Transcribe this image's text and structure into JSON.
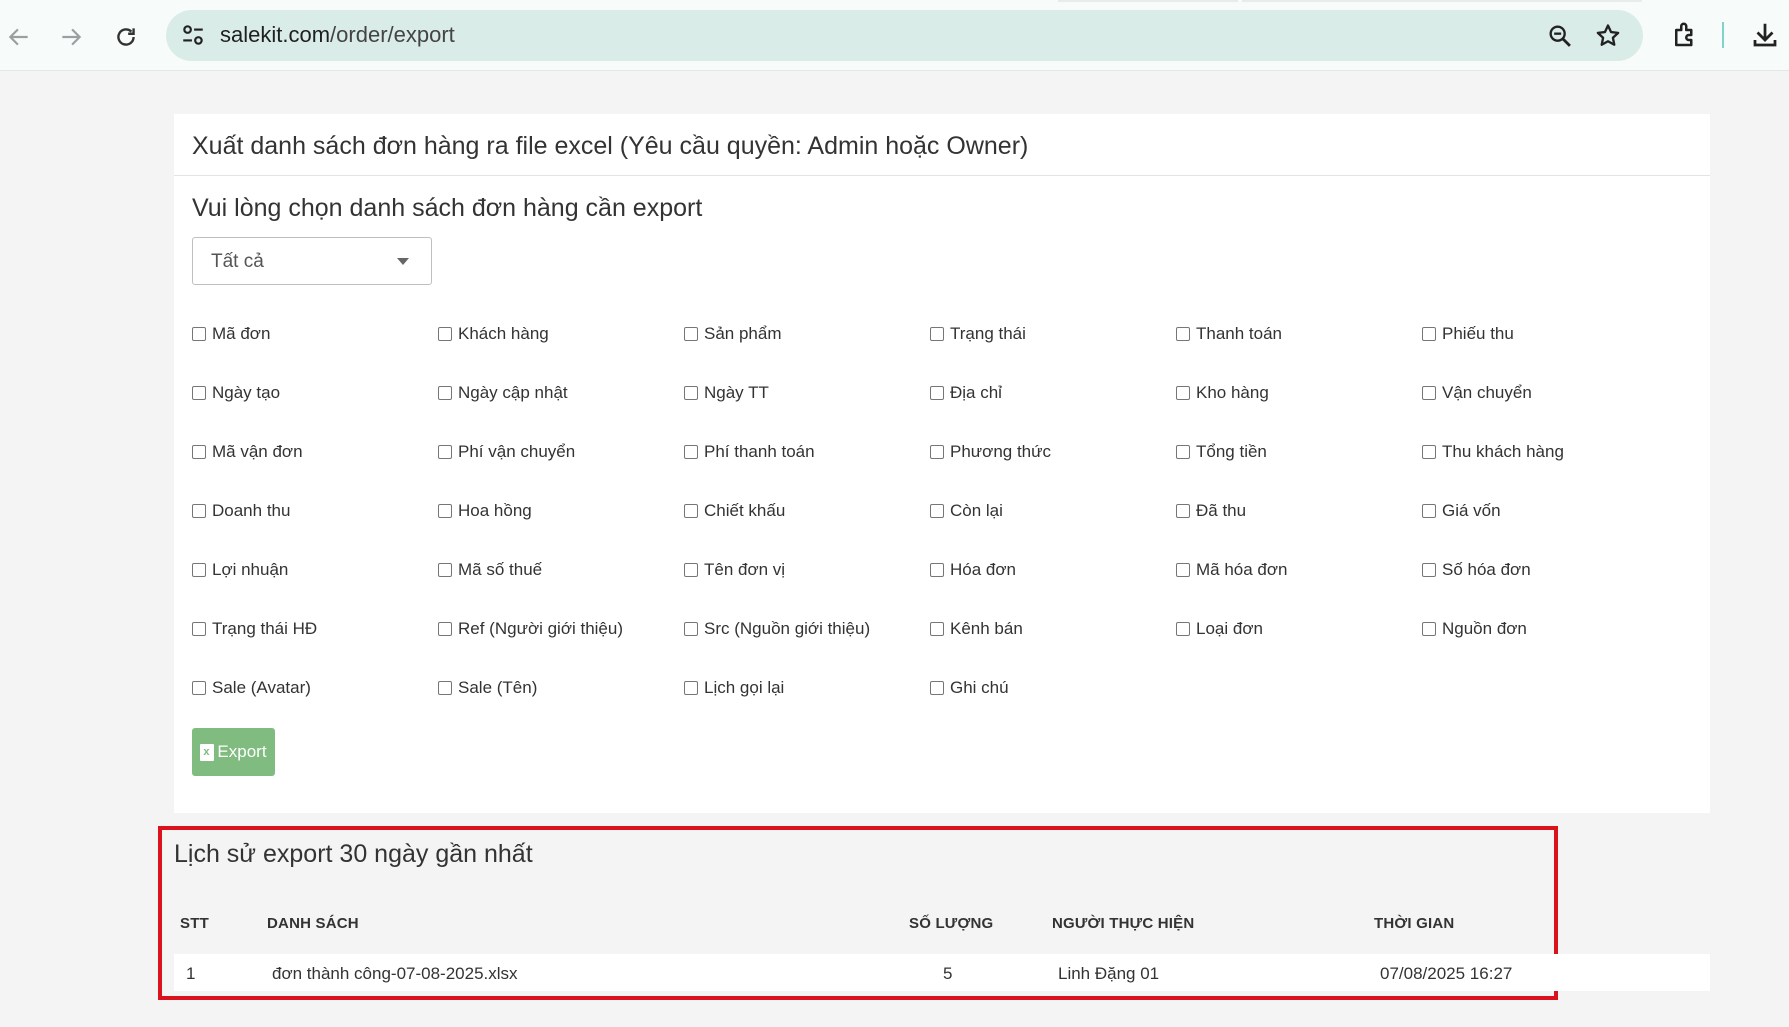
{
  "browser": {
    "url_host": "salekit.com",
    "url_path": "/order/export"
  },
  "card": {
    "title": "Xuất danh sách đơn hàng ra file excel (Yêu cầu quyền: Admin hoặc Owner)",
    "subtitle": "Vui lòng chọn danh sách đơn hàng cần export",
    "select_value": "Tất cả",
    "fields": [
      "Mã đơn",
      "Khách hàng",
      "Sản phẩm",
      "Trạng thái",
      "Thanh toán",
      "Phiếu thu",
      "Ngày tạo",
      "Ngày cập nhật",
      "Ngày TT",
      "Địa chỉ",
      "Kho hàng",
      "Vận chuyển",
      "Mã vận đơn",
      "Phí vận chuyển",
      "Phí thanh toán",
      "Phương thức",
      "Tổng tiền",
      "Thu khách hàng",
      "Doanh thu",
      "Hoa hồng",
      "Chiết khấu",
      "Còn lại",
      "Đã thu",
      "Giá vốn",
      "Lợi nhuận",
      "Mã số thuế",
      "Tên đơn vị",
      "Hóa đơn",
      "Mã hóa đơn",
      "Số hóa đơn",
      "Trạng thái HĐ",
      "Ref (Người giới thiệu)",
      "Src (Nguồn giới thiệu)",
      "Kênh bán",
      "Loại đơn",
      "Nguồn đơn",
      "Sale (Avatar)",
      "Sale (Tên)",
      "Lịch gọi lại",
      "Ghi chú"
    ],
    "export_label": "Export",
    "export_icon_letter": "x"
  },
  "history": {
    "title": "Lịch sử export 30 ngày gần nhất",
    "columns": {
      "stt": "STT",
      "list": "DANH SÁCH",
      "qty": "SỐ LƯỢNG",
      "user": "NGƯỜI THỰC HIỆN",
      "time": "THỜI GIAN"
    },
    "rows": [
      {
        "stt": "1",
        "list": "đơn thành công-07-08-2025.xlsx",
        "qty": "5",
        "user": "Linh Đặng 01",
        "time": "07/08/2025 16:27"
      }
    ]
  },
  "colors": {
    "export_button": "#80bb80",
    "highlight_frame": "#d9121d",
    "omnibox": "#daece8"
  },
  "icons": [
    "back-arrow-icon",
    "forward-arrow-icon",
    "reload-icon",
    "site-settings-icon",
    "zoom-icon",
    "bookmark-star-icon",
    "extensions-icon",
    "download-icon",
    "excel-file-icon",
    "dropdown-caret-icon",
    "checkbox-icon"
  ]
}
